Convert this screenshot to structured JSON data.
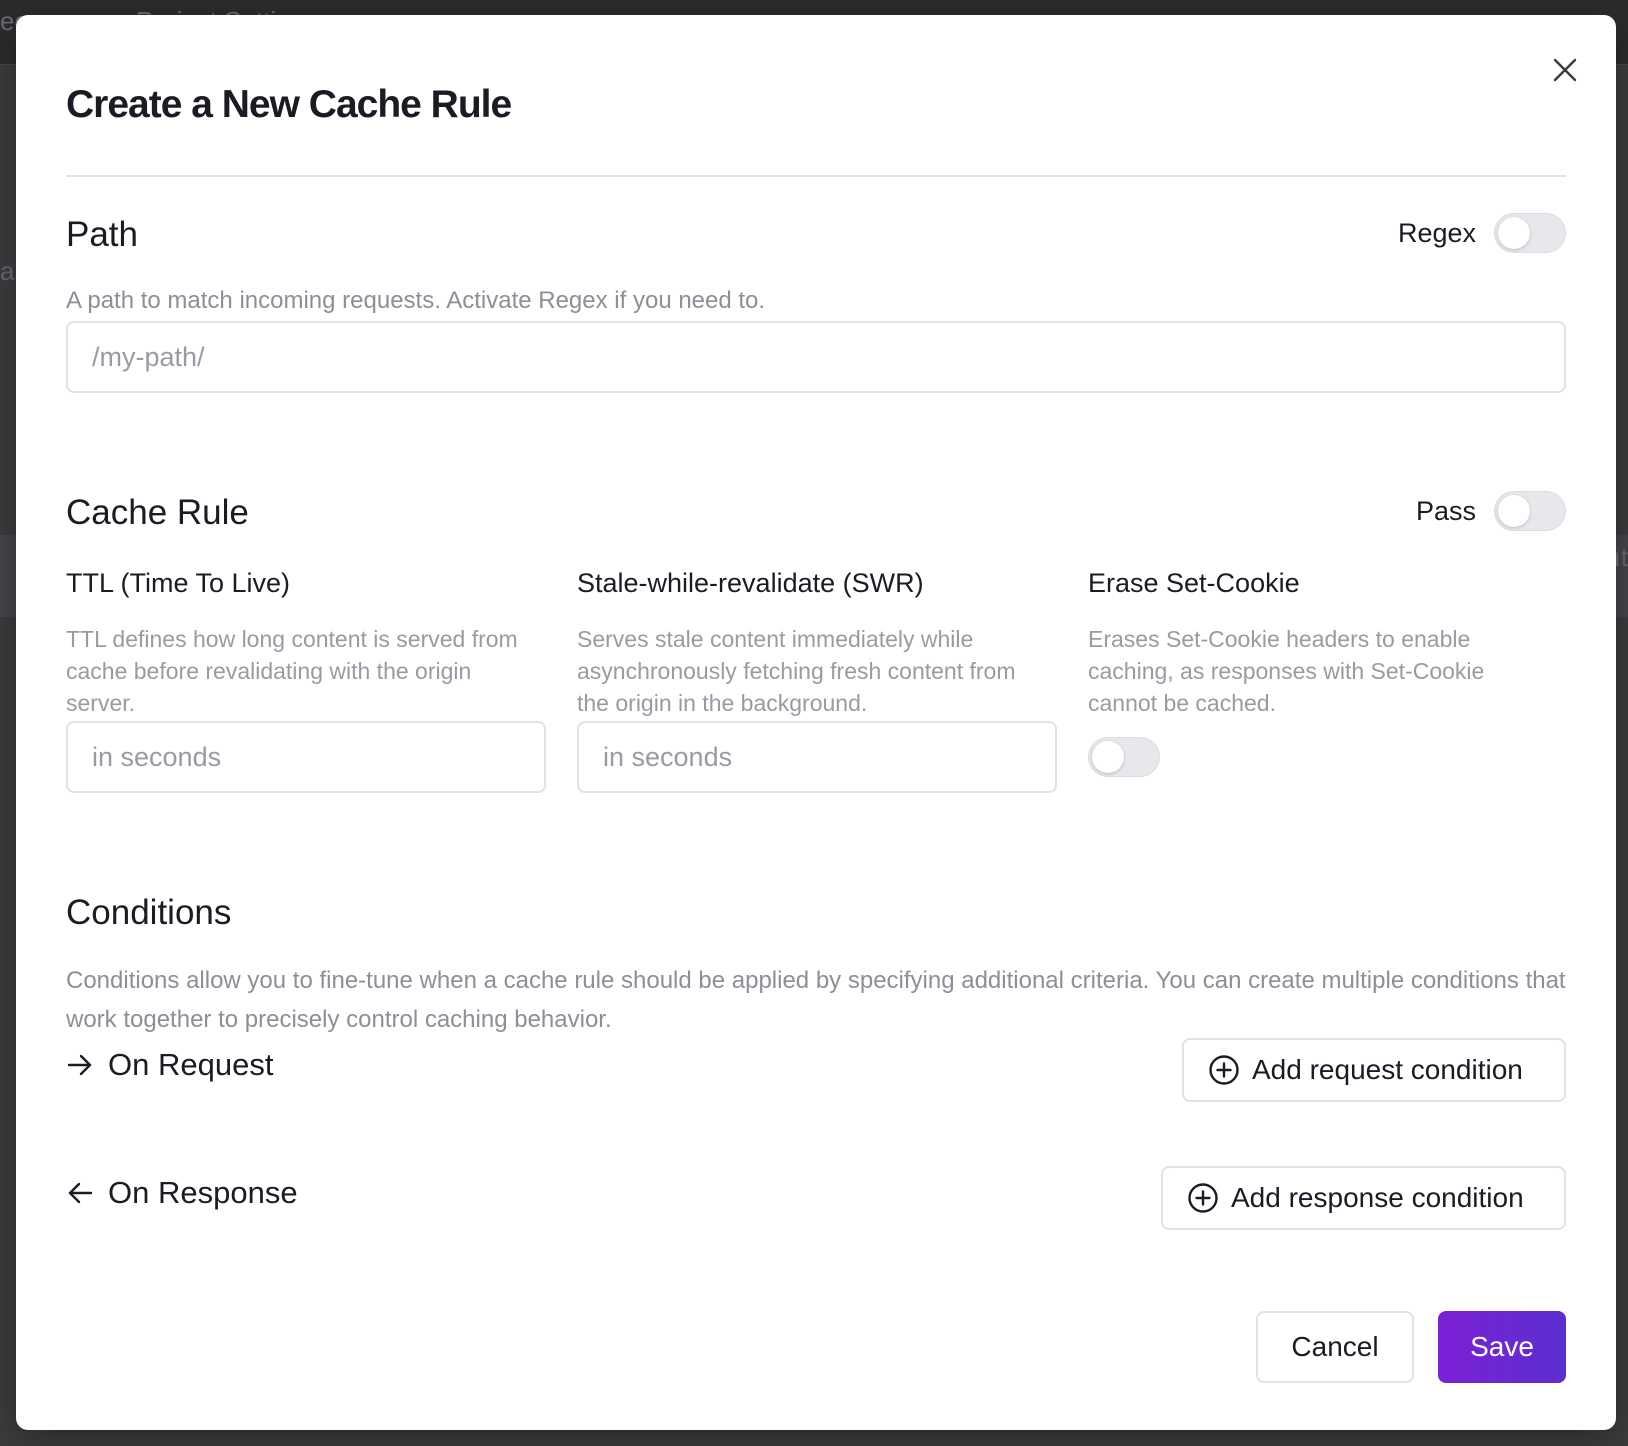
{
  "backdrop": {
    "top_left_text": "ec",
    "top_text": "Project Settings",
    "left_edge_text": "ar",
    "right_edge_text": "ıt"
  },
  "modal": {
    "title": "Create a New Cache Rule",
    "close_icon": "close-icon"
  },
  "path": {
    "title": "Path",
    "regex_label": "Regex",
    "regex_on": false,
    "description": "A path to match incoming requests. Activate Regex if you need to.",
    "input_placeholder": "/my-path/",
    "input_value": ""
  },
  "cache_rule": {
    "title": "Cache Rule",
    "pass_label": "Pass",
    "pass_on": false,
    "ttl": {
      "title": "TTL (Time To Live)",
      "description": "TTL defines how long content is served from cache before revalidating with the origin server.",
      "placeholder": "in seconds"
    },
    "swr": {
      "title": "Stale-while-revalidate (SWR)",
      "description": "Serves stale content immediately while asynchronously fetching fresh content from the origin in the background.",
      "placeholder": "in seconds"
    },
    "erase_cookie": {
      "title": "Erase Set-Cookie",
      "description": "Erases Set-Cookie headers to enable caching, as responses with Set-Cookie cannot be cached.",
      "enabled": false
    }
  },
  "conditions": {
    "title": "Conditions",
    "description": "Conditions allow you to fine-tune when a cache rule should be applied by specifying additional criteria. You can create multiple conditions that work together to precisely control caching behavior.",
    "on_request_label": "On Request",
    "on_request_icon": "arrow-right-icon",
    "add_request_label": "Add request condition",
    "on_response_label": "On Response",
    "on_response_icon": "arrow-left-icon",
    "add_response_label": "Add response condition",
    "add_icon": "plus-circle-icon"
  },
  "footer": {
    "cancel_label": "Cancel",
    "save_label": "Save"
  },
  "colors": {
    "primary_gradient_start": "#7c1fd6",
    "primary_gradient_end": "#5b2fd0",
    "text": "#1c1a24",
    "muted": "#8e8e98",
    "border": "#e2e2e6"
  }
}
